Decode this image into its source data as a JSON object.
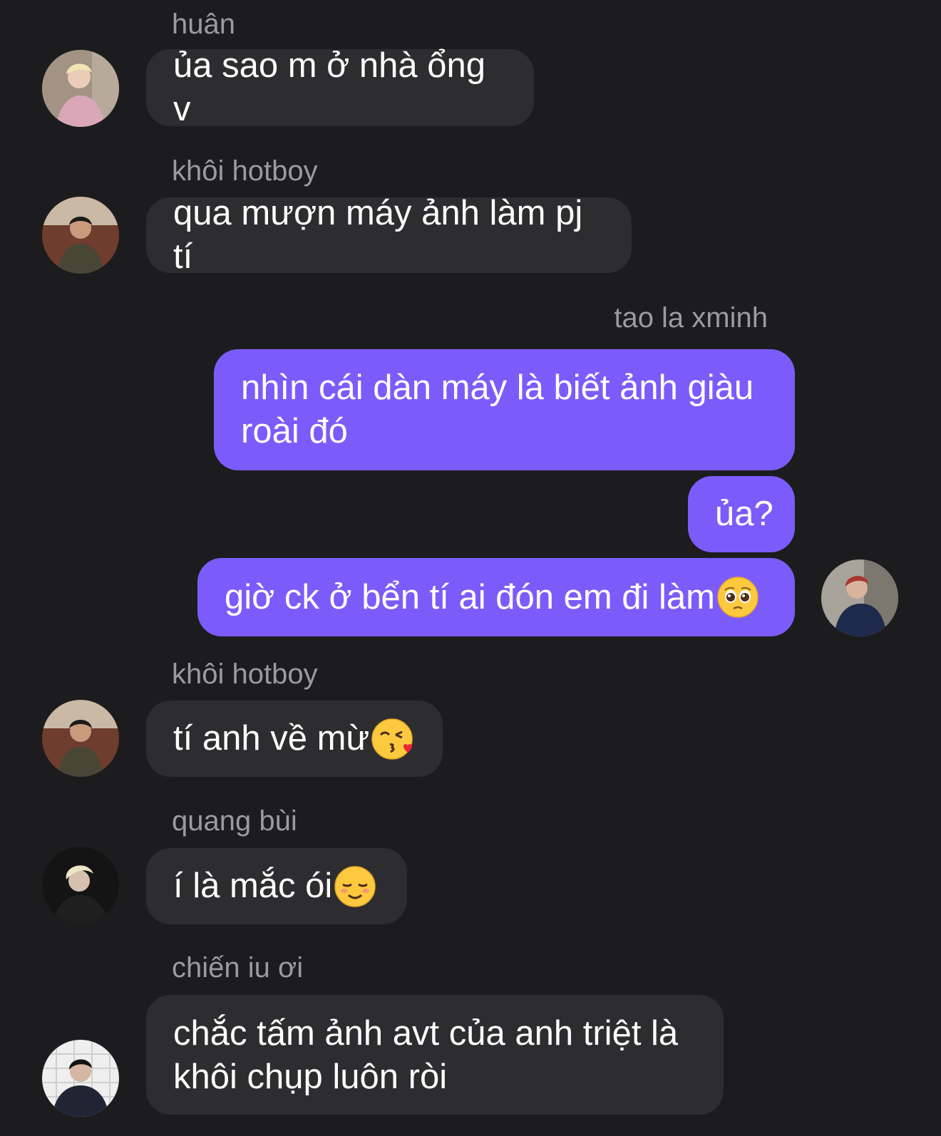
{
  "messages": [
    {
      "sender": "huân",
      "text": "ủa sao m ở nhà ổng v",
      "avatar": "avatar-huan"
    },
    {
      "sender": "khôi hotboy",
      "text": "qua mượn máy ảnh làm pj tí",
      "avatar": "avatar-khoi"
    },
    {
      "sender": "tao la xminh",
      "outgoing": [
        {
          "text_line1": "nhìn cái dàn máy là biết ảnh giàu",
          "text_line2": "roài đó"
        },
        {
          "text": "ủa?"
        },
        {
          "text": "giờ ck ở bển tí ai đón em đi làm",
          "emoji": "pleading-face-icon"
        }
      ],
      "avatar": "avatar-xminh"
    },
    {
      "sender": "khôi hotboy",
      "text": "tí anh về mừ",
      "emoji": "kissing-heart-face-icon",
      "avatar": "avatar-khoi"
    },
    {
      "sender": "quang bùi",
      "text": "í là mắc ói",
      "emoji": "smiling-blushing-face-icon",
      "avatar": "avatar-quang"
    },
    {
      "sender": "chiến iu ơi",
      "text_line1": "chắc tấm ảnh avt của anh triệt là",
      "text_line2": "khôi chụp luôn ròi",
      "avatar": "avatar-chien"
    }
  ],
  "colors": {
    "background": "#1c1c1e",
    "incoming_bubble": "#2d2d30",
    "outgoing_bubble": "#7b5cfa",
    "sender_name": "#9a9aa0",
    "message_text": "#ffffff"
  }
}
